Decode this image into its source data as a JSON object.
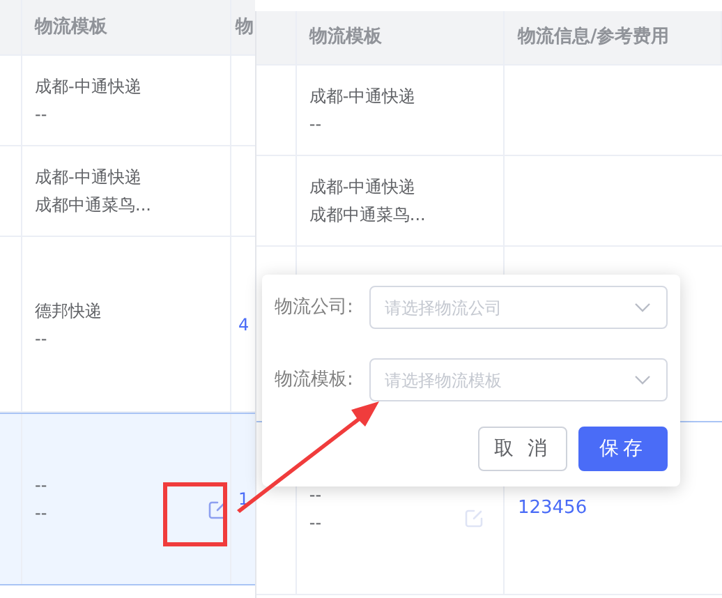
{
  "left_table": {
    "columns": [
      "物流模板",
      "物"
    ],
    "rows": [
      {
        "lines": [
          "成都-中通快递",
          "--"
        ],
        "column_3": "",
        "selected": false,
        "edit": false
      },
      {
        "lines": [
          "成都-中通快递",
          "成都中通菜鸟..."
        ],
        "column_3": "",
        "selected": false,
        "edit": false
      },
      {
        "lines": [
          "德邦快递",
          "--"
        ],
        "column_3": "4",
        "selected": false,
        "edit": false
      },
      {
        "lines": [
          "--",
          "--"
        ],
        "column_3": "1",
        "selected": true,
        "edit": true
      }
    ]
  },
  "right_table": {
    "columns": [
      "物流模板",
      "物流信息/参考费用"
    ],
    "rows": [
      {
        "lines": [
          "成都-中通快递",
          "--"
        ],
        "info": "",
        "selected": false,
        "edit": false
      },
      {
        "lines": [
          "成都-中通快递",
          "成都中通菜鸟..."
        ],
        "info": "",
        "selected": false,
        "edit": false
      },
      {
        "lines": [],
        "info": "",
        "selected": false,
        "edit": false
      },
      {
        "lines": [
          "--",
          "--"
        ],
        "info": "123456",
        "selected": false,
        "edit": true
      }
    ]
  },
  "popover": {
    "fields": [
      {
        "label": "物流公司:",
        "placeholder": "请选择物流公司"
      },
      {
        "label": "物流模板:",
        "placeholder": "请选择物流模板"
      }
    ],
    "buttons": [
      {
        "label": "取 消",
        "kind": "default"
      },
      {
        "label": "保存",
        "kind": "primary"
      }
    ]
  }
}
